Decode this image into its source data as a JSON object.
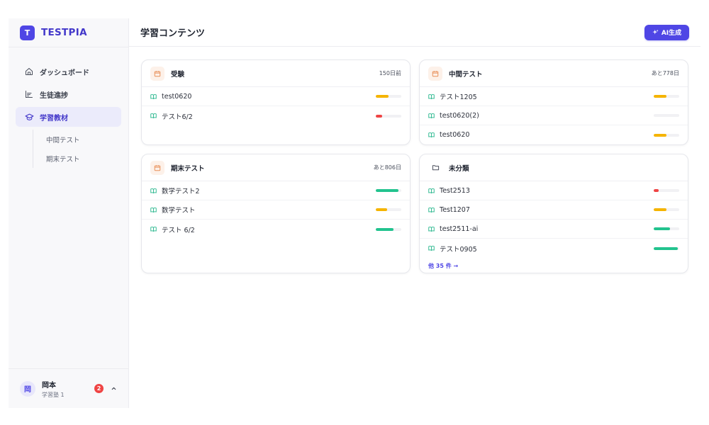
{
  "brand": {
    "logo_letter": "T",
    "name": "TESTPIA"
  },
  "sidebar": {
    "items": [
      {
        "label": "ダッシュボード",
        "icon": "home-icon"
      },
      {
        "label": "生徒進捗",
        "icon": "bar-chart-icon"
      },
      {
        "label": "学習教材",
        "icon": "graduation-cap-icon",
        "active": true
      }
    ],
    "sub_items": [
      {
        "label": "中間テスト"
      },
      {
        "label": "期末テスト"
      }
    ]
  },
  "user": {
    "avatar": "岡",
    "name": "岡本",
    "role": "学習塾 1",
    "notification_count": "2"
  },
  "header": {
    "title": "学習コンテンツ",
    "ai_button": "AI生成"
  },
  "cards": [
    {
      "title": "受験",
      "meta": "150日前",
      "icon": "calendar-icon",
      "rows": [
        {
          "label": "test0620",
          "progress": 0.5,
          "color": "#f5b400"
        },
        {
          "label": "テスト6/2",
          "progress": 0.25,
          "color": "#ef4444"
        }
      ]
    },
    {
      "title": "中間テスト",
      "meta": "あと778日",
      "icon": "calendar-icon",
      "rows": [
        {
          "label": "テスト1205",
          "progress": 0.5,
          "color": "#f5b400"
        },
        {
          "label": "test0620(2)",
          "progress": 0.0,
          "color": "#f5b400"
        },
        {
          "label": "test0620",
          "progress": 0.5,
          "color": "#f5b400"
        }
      ]
    },
    {
      "title": "期末テスト",
      "meta": "あと806日",
      "icon": "calendar-icon",
      "rows": [
        {
          "label": "数学テスト2",
          "progress": 0.9,
          "color": "#22c38e"
        },
        {
          "label": "数学テスト",
          "progress": 0.45,
          "color": "#f5b400"
        },
        {
          "label": "テスト 6/2",
          "progress": 0.7,
          "color": "#22c38e"
        }
      ]
    },
    {
      "title": "未分類",
      "meta": "",
      "icon": "folder-icon",
      "rows": [
        {
          "label": "Test2513",
          "progress": 0.2,
          "color": "#ef4444"
        },
        {
          "label": "Test1207",
          "progress": 0.5,
          "color": "#f5b400"
        },
        {
          "label": "test2511-ai",
          "progress": 0.65,
          "color": "#22c38e"
        },
        {
          "label": "テスト0905",
          "progress": 0.95,
          "color": "#22c38e"
        }
      ],
      "more_link": "他 35 件 →"
    }
  ],
  "colors": {
    "accent": "#4f46e5",
    "yellow": "#f5b400",
    "red": "#ef4444",
    "green": "#22c38e"
  }
}
